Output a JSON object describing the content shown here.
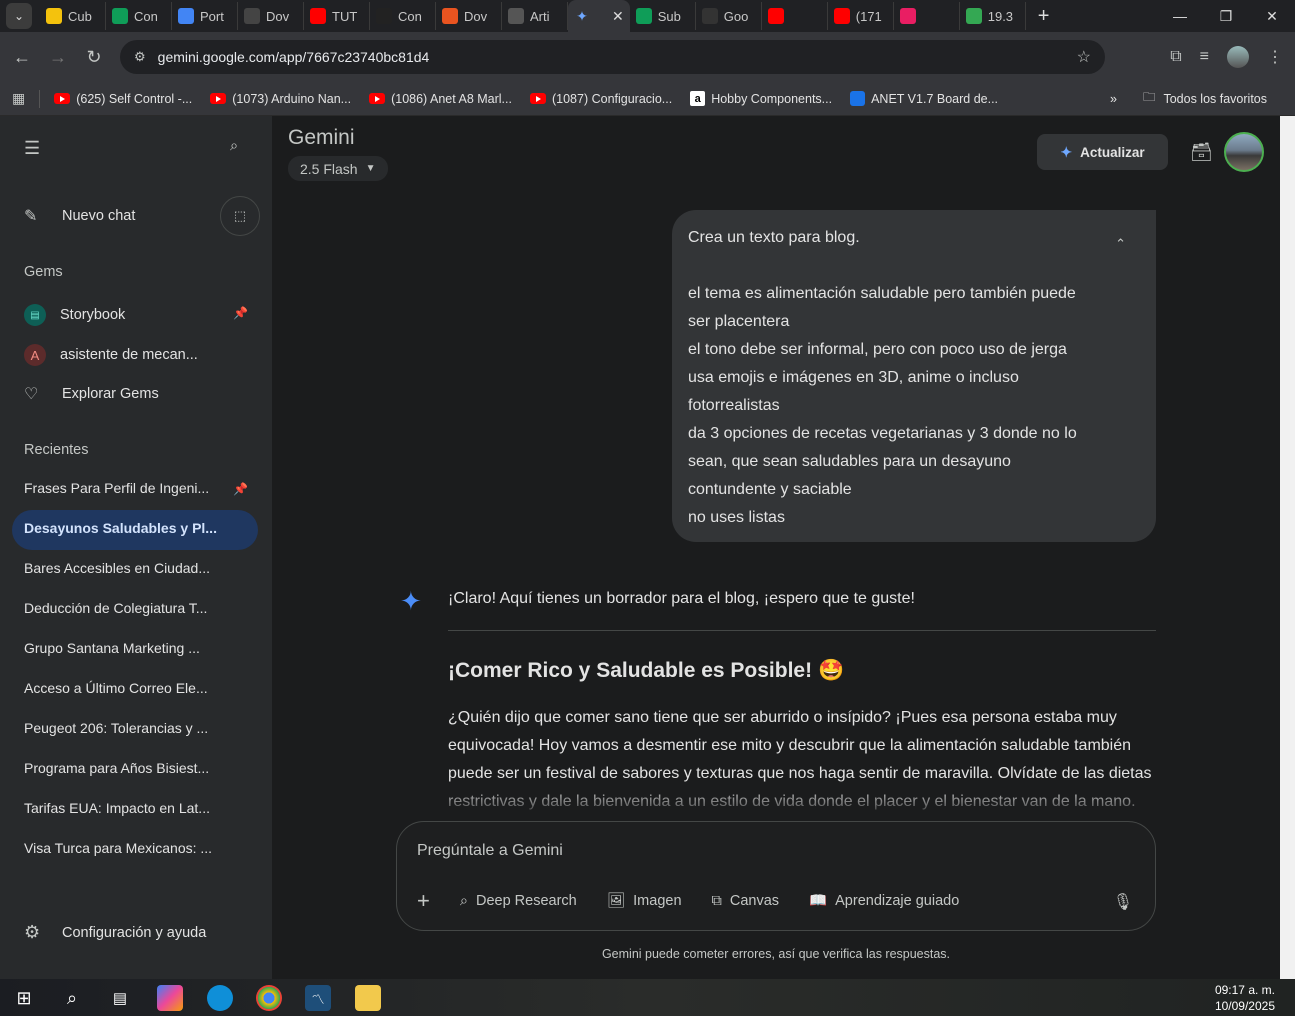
{
  "browser": {
    "tabs": [
      {
        "label": "Cub",
        "color": "#f4c20d"
      },
      {
        "label": "Con",
        "color": "#0f9d58"
      },
      {
        "label": "Port",
        "color": "#4285f4"
      },
      {
        "label": "Dov",
        "color": "#444444"
      },
      {
        "label": "TUT",
        "color": "#ff0000"
      },
      {
        "label": "Con",
        "color": "#222222"
      },
      {
        "label": "Dov",
        "color": "#e95420"
      },
      {
        "label": "Arti",
        "color": "#555555"
      }
    ],
    "active_tab": {
      "close": "✕"
    },
    "tabs_right": [
      {
        "label": "Sub",
        "color": "#0f9d58"
      },
      {
        "label": "Goo",
        "color": "#333333"
      },
      {
        "label": "",
        "color": "#ff0000"
      },
      {
        "label": "(171",
        "color": "#ff0000"
      },
      {
        "label": "",
        "color": "#e91e63"
      },
      {
        "label": "19.3",
        "color": "#34a853"
      }
    ],
    "url": "gemini.google.com/app/7667c23740bc81d4",
    "bookmarks": [
      {
        "label": "(625) Self Control -...",
        "type": "yt"
      },
      {
        "label": "(1073) Arduino Nan...",
        "type": "yt"
      },
      {
        "label": "(1086) Anet A8 Marl...",
        "type": "yt"
      },
      {
        "label": "(1087) Configuracio...",
        "type": "yt"
      },
      {
        "label": "Hobby Components...",
        "type": "amazon"
      },
      {
        "label": "ANET V1.7 Board de...",
        "type": "other"
      }
    ],
    "all_bookmarks": "Todos los favoritos"
  },
  "sidebar": {
    "new_chat": "Nuevo chat",
    "gems_heading": "Gems",
    "gems": [
      {
        "label": "Storybook",
        "icon": "storybook-icon"
      },
      {
        "label": "asistente de mecan...",
        "initial": "A"
      },
      {
        "label": "Explorar Gems",
        "icon": "gem-explore-icon"
      }
    ],
    "recents_heading": "Recientes",
    "recents": [
      "Frases Para Perfil de Ingeni...",
      "Desayunos Saludables y Pl...",
      "Bares Accesibles en Ciudad...",
      "Deducción de Colegiatura T...",
      "Grupo Santana Marketing ...",
      "Acceso a Último Correo Ele...",
      "Peugeot 206: Tolerancias y ...",
      "Programa para Años Bisiest...",
      "Tarifas EUA: Impacto en Lat...",
      "Visa Turca para Mexicanos: ..."
    ],
    "settings": "Configuración y ayuda"
  },
  "header": {
    "brand": "Gemini",
    "model": "2.5 Flash",
    "upgrade": "Actualizar"
  },
  "conversation": {
    "user_lines": [
      "Crea un texto para blog.",
      "",
      "el tema es alimentación saludable pero también puede",
      "ser placentera",
      "el tono debe ser informal, pero con poco uso de jerga",
      "usa emojis e imágenes en 3D, anime o incluso",
      "fotorrealistas",
      "da 3 opciones de recetas vegetarianas y 3 donde no lo",
      "sean, que sean saludables para un desayuno",
      "contundente y saciable",
      "no uses listas"
    ],
    "response_intro": "¡Claro! Aquí tienes un borrador para el blog, ¡espero que te guste!",
    "response_title": "¡Comer Rico y Saludable es Posible! 🤩",
    "response_body": "¿Quién dijo que comer sano tiene que ser aburrido o insípido? ¡Pues esa persona estaba muy equivocada! Hoy vamos a desmentir ese mito y descubrir que la alimentación saludable también puede ser un festival de sabores y texturas que nos haga sentir de maravilla. Olvídate de las dietas restrictivas y dale la bienvenida a un estilo de vida donde el placer y el bienestar van de la mano."
  },
  "composer": {
    "placeholder": "Pregúntale a Gemini",
    "tools": [
      "Deep Research",
      "Imagen",
      "Canvas",
      "Aprendizaje guiado"
    ]
  },
  "disclaimer": "Gemini puede cometer errores, así que verifica las respuestas.",
  "taskbar": {
    "time": "09:17 a. m.",
    "date": "10/09/2025"
  }
}
